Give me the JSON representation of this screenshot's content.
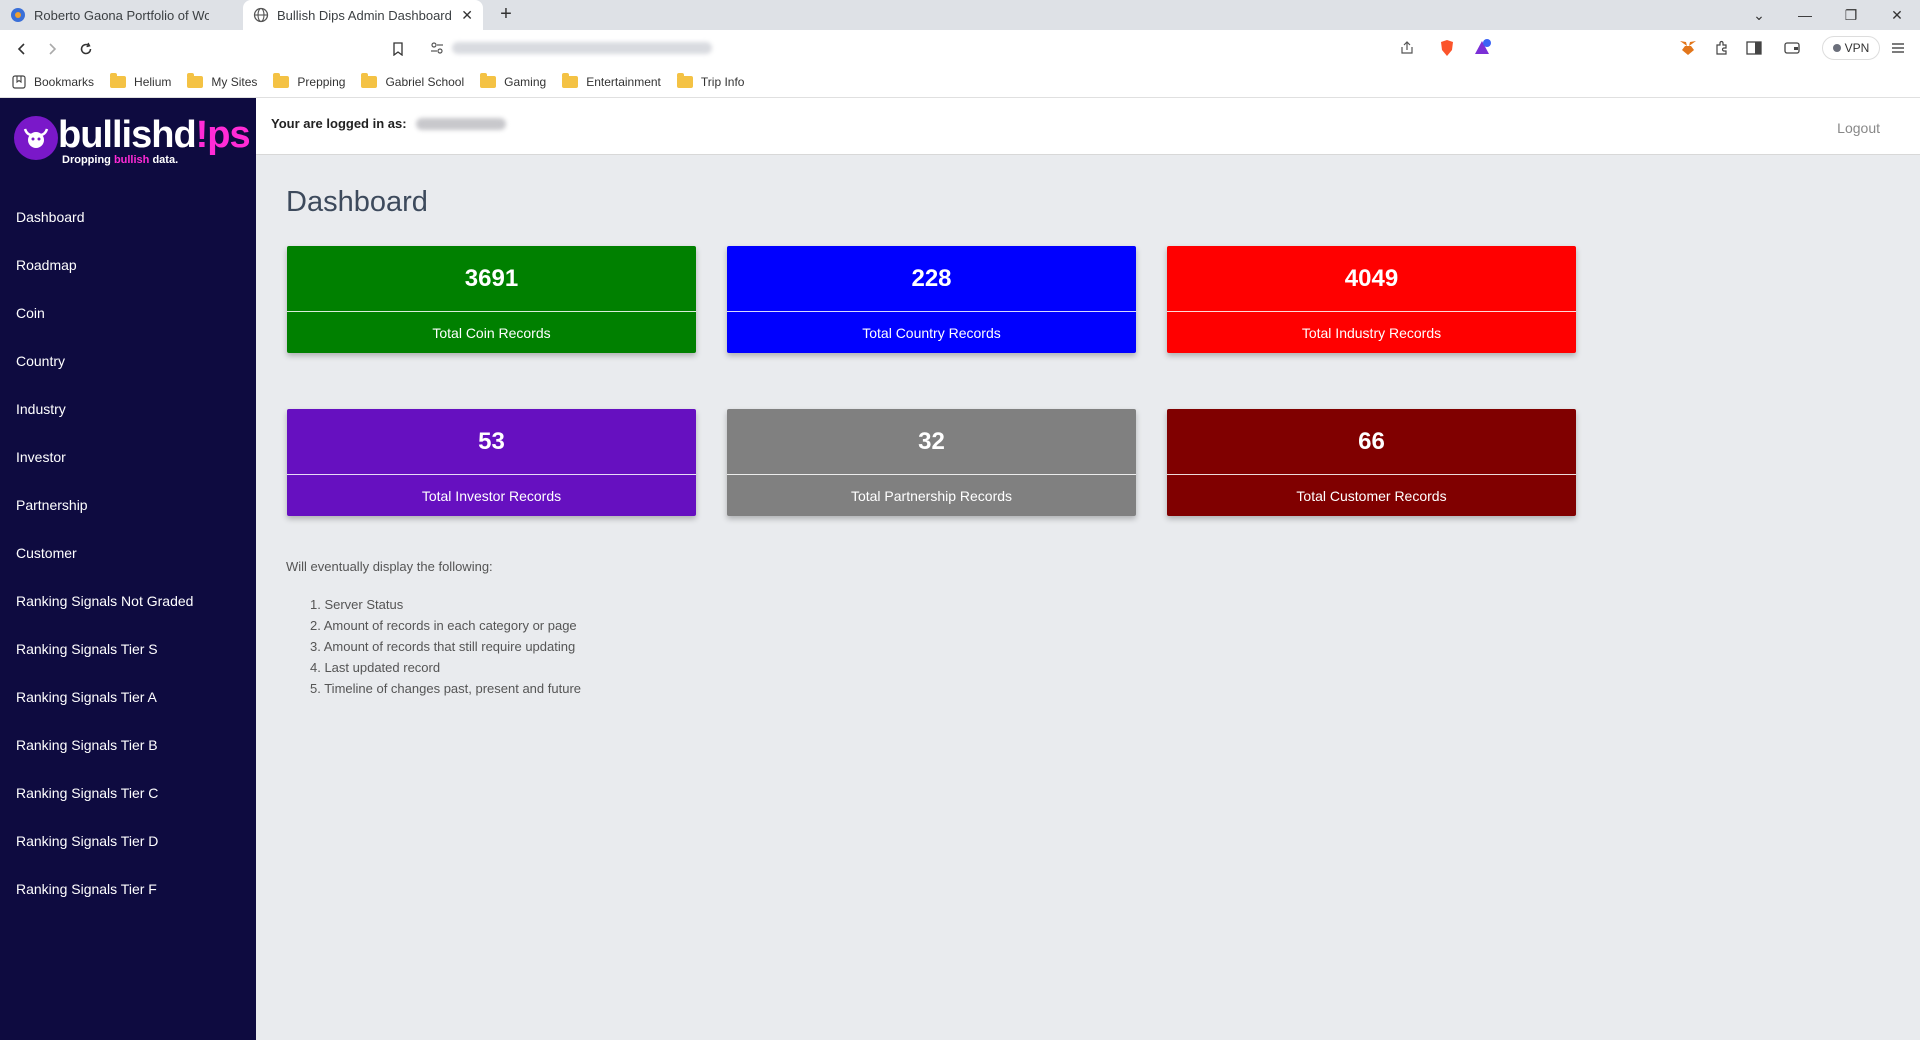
{
  "browser": {
    "tabs": [
      {
        "title": "Roberto Gaona Portfolio of Work | SoC",
        "active": false
      },
      {
        "title": "Bullish Dips Admin Dashboard",
        "active": true
      }
    ],
    "vpn_label": "VPN",
    "bookmarks": [
      "Bookmarks",
      "Helium",
      "My Sites",
      "Prepping",
      "Gabriel School",
      "Gaming",
      "Entertainment",
      "Trip Info"
    ]
  },
  "logo": {
    "text_main": "bullishd",
    "text_accent": "!ps",
    "tagline_start": "Dropping ",
    "tagline_accent": "bullish",
    "tagline_end": " data."
  },
  "sidebar": {
    "items": [
      {
        "label": "Dashboard"
      },
      {
        "label": "Roadmap"
      },
      {
        "label": "Coin"
      },
      {
        "label": "Country"
      },
      {
        "label": "Industry"
      },
      {
        "label": "Investor"
      },
      {
        "label": "Partnership"
      },
      {
        "label": "Customer"
      },
      {
        "label": "Ranking Signals Not Graded"
      },
      {
        "label": "Ranking Signals Tier S"
      },
      {
        "label": "Ranking Signals Tier A"
      },
      {
        "label": "Ranking Signals Tier B"
      },
      {
        "label": "Ranking Signals Tier C"
      },
      {
        "label": "Ranking Signals Tier D"
      },
      {
        "label": "Ranking Signals Tier F"
      }
    ]
  },
  "header": {
    "login_label": "Your are logged in as:",
    "logout": "Logout"
  },
  "main": {
    "title": "Dashboard",
    "cards": [
      {
        "value": "3691",
        "label": "Total Coin Records",
        "color": "#008000"
      },
      {
        "value": "228",
        "label": "Total Country Records",
        "color": "#0000ff"
      },
      {
        "value": "4049",
        "label": "Total Industry Records",
        "color": "#ff0000"
      },
      {
        "value": "53",
        "label": "Total Investor Records",
        "color": "#6610c0"
      },
      {
        "value": "32",
        "label": "Total Partnership Records",
        "color": "#808080"
      },
      {
        "value": "66",
        "label": "Total Customer Records",
        "color": "#800000"
      }
    ],
    "notes_intro": "Will eventually display the following:",
    "notes": [
      "1. Server Status",
      "2. Amount of records in each category or page",
      "3. Amount of records that still require updating",
      "4. Last updated record",
      "5. Timeline of changes past, present and future"
    ]
  }
}
